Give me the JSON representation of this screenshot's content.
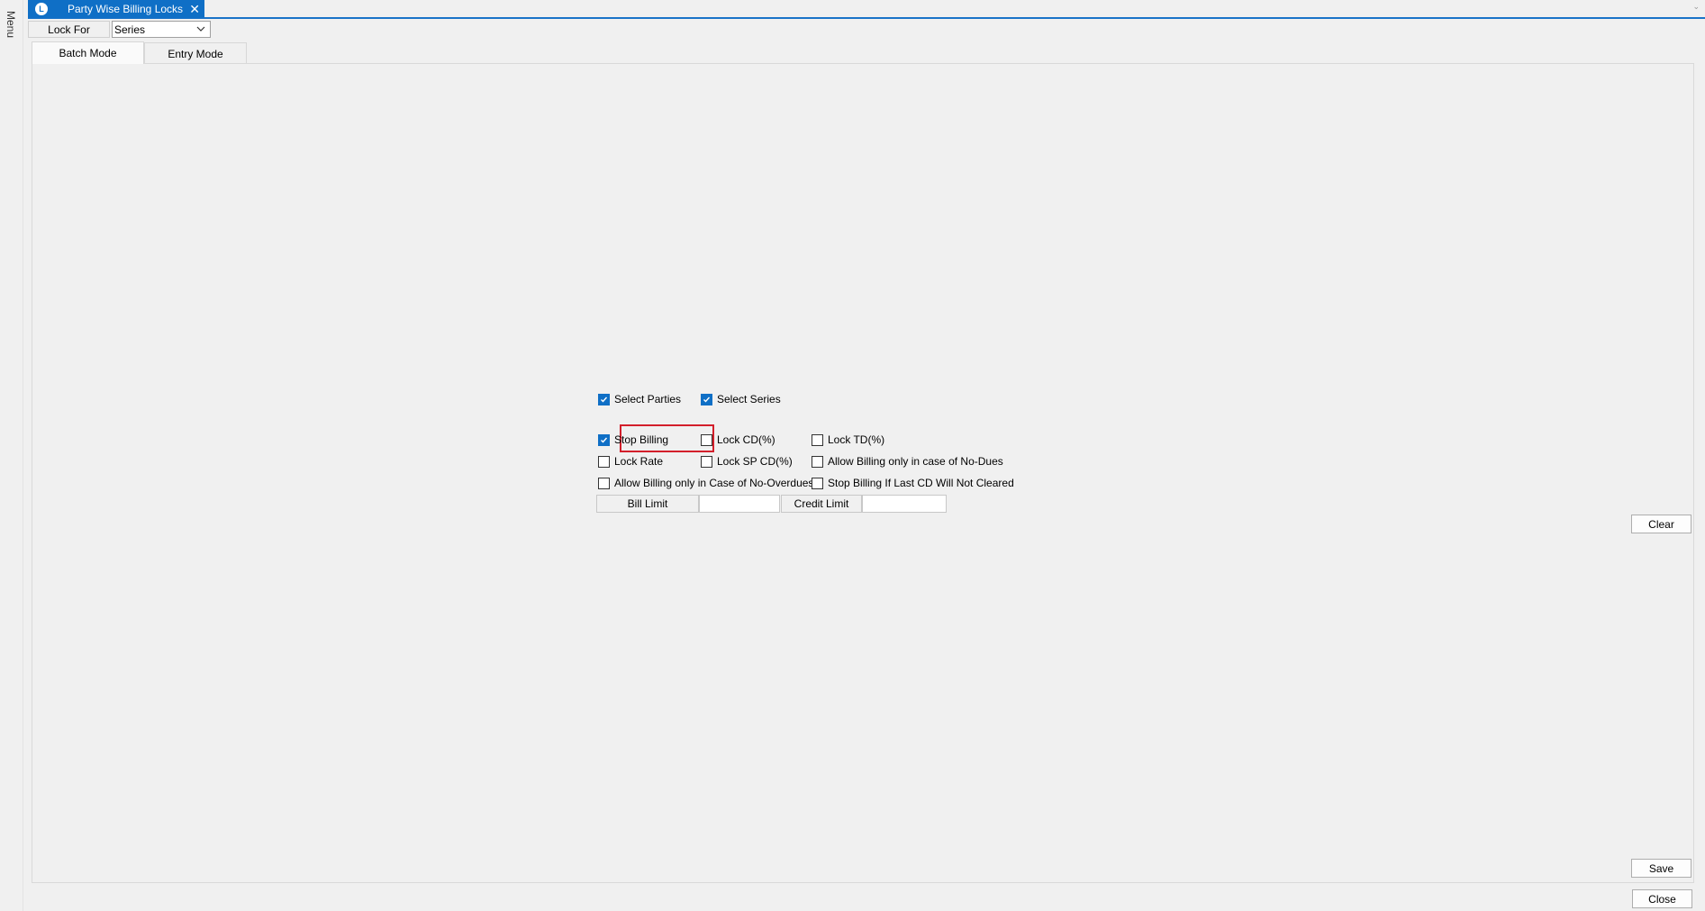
{
  "menu_strip": {
    "label": "Menu"
  },
  "window": {
    "tab_title": "Party Wise Billing Locks",
    "close_symbol": "✕"
  },
  "lock_for": {
    "label": "Lock For",
    "selected": "Series"
  },
  "tabs": [
    {
      "label": "Batch Mode",
      "active": true
    },
    {
      "label": "Entry Mode",
      "active": false
    }
  ],
  "selection": {
    "select_parties": {
      "label": "Select Parties",
      "checked": true
    },
    "select_series": {
      "label": "Select Series",
      "checked": true
    }
  },
  "options": {
    "stop_billing": {
      "label": "Stop Billing",
      "checked": true
    },
    "lock_cd": {
      "label": "Lock CD(%)",
      "checked": false
    },
    "lock_td": {
      "label": "Lock TD(%)",
      "checked": false
    },
    "lock_rate": {
      "label": "Lock Rate",
      "checked": false
    },
    "lock_sp_cd": {
      "label": "Lock SP CD(%)",
      "checked": false
    },
    "allow_no_dues": {
      "label": "Allow Billing only in case of No-Dues",
      "checked": false
    },
    "allow_no_overdues": {
      "label": "Allow Billing only in Case of No-Overdues",
      "checked": false
    },
    "stop_billing_cd": {
      "label": "Stop  Billing If Last CD Will Not Cleared",
      "checked": false
    }
  },
  "limits": {
    "bill_limit_label": "Bill Limit",
    "bill_limit_value": "",
    "credit_limit_label": "Credit Limit",
    "credit_limit_value": ""
  },
  "buttons": {
    "clear": "Clear",
    "save": "Save",
    "close": "Close"
  },
  "colors": {
    "accent": "#0f6fc6",
    "highlight": "#d31f2b"
  }
}
